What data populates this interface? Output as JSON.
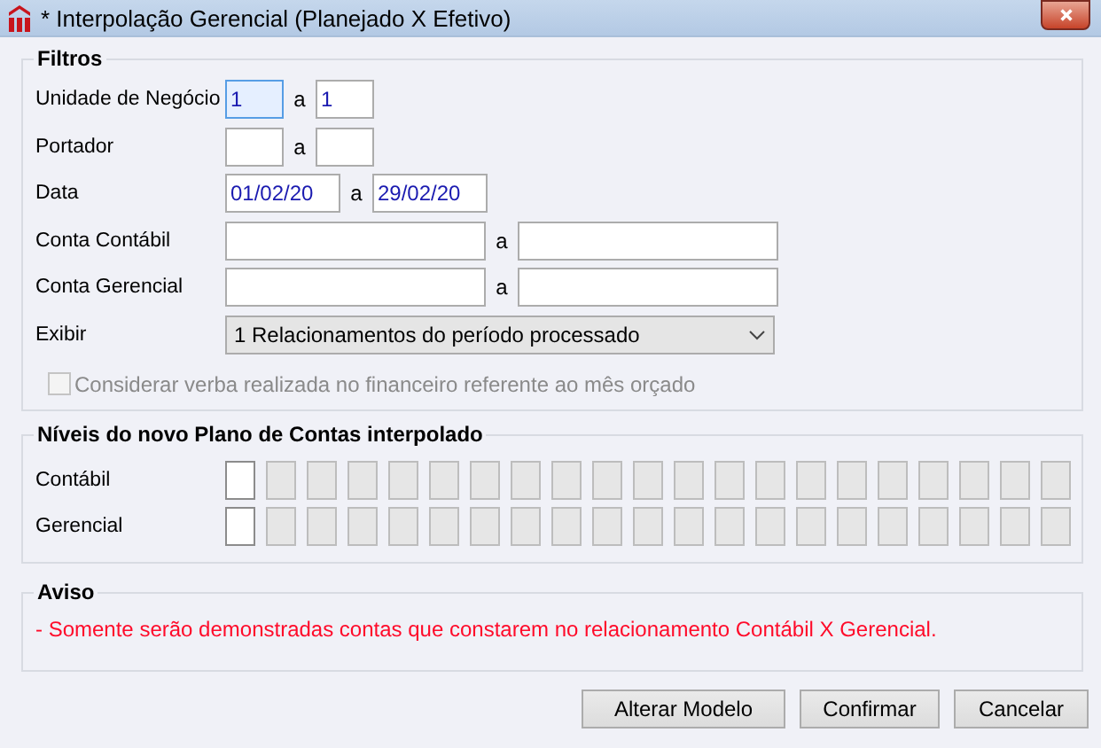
{
  "window": {
    "title": "* Interpolação Gerencial (Planejado X Efetivo)"
  },
  "filters": {
    "title": "Filtros",
    "rows": [
      {
        "kind": "range",
        "label": "Unidade de Negócio",
        "separator": "a",
        "from": {
          "value": "1",
          "focused": true
        },
        "to": {
          "value": "1",
          "focused": false
        }
      },
      {
        "kind": "range",
        "label": "Portador",
        "separator": "a",
        "from": {
          "focused": false
        },
        "to": {
          "focused": false
        }
      },
      {
        "kind": "range",
        "label": "Data",
        "separator": "a",
        "from": {
          "value": "01/02/20",
          "focused": false
        },
        "to": {
          "value": "29/02/20",
          "focused": false
        }
      },
      {
        "kind": "range",
        "label": "Conta Contábil",
        "separator": "a",
        "from": {
          "focused": false
        },
        "to": {
          "focused": false
        }
      },
      {
        "kind": "range",
        "label": "Conta Gerencial",
        "separator": "a",
        "from": {
          "focused": false
        },
        "to": {
          "focused": false
        }
      },
      {
        "kind": "select",
        "label": "Exibir",
        "value": "1 Relacionamentos do período processado"
      }
    ],
    "checkbox": {
      "label": "Considerar verba realizada no financeiro referente ao mês orçado",
      "checked": false,
      "disabled": true
    }
  },
  "levels": {
    "title": "Níveis do novo Plano de Contas interpolado",
    "rows": [
      {
        "label": "Contábil",
        "boxes": [
          {
            "disabled": false
          },
          {
            "disabled": true
          },
          {
            "disabled": true
          },
          {
            "disabled": true
          },
          {
            "disabled": true
          },
          {
            "disabled": true
          },
          {
            "disabled": true
          },
          {
            "disabled": true
          },
          {
            "disabled": true
          },
          {
            "disabled": true
          },
          {
            "disabled": true
          },
          {
            "disabled": true
          },
          {
            "disabled": true
          },
          {
            "disabled": true
          },
          {
            "disabled": true
          },
          {
            "disabled": true
          },
          {
            "disabled": true
          },
          {
            "disabled": true
          },
          {
            "disabled": true
          },
          {
            "disabled": true
          },
          {
            "disabled": true
          }
        ]
      },
      {
        "label": "Gerencial",
        "boxes": [
          {
            "disabled": false
          },
          {
            "disabled": true
          },
          {
            "disabled": true
          },
          {
            "disabled": true
          },
          {
            "disabled": true
          },
          {
            "disabled": true
          },
          {
            "disabled": true
          },
          {
            "disabled": true
          },
          {
            "disabled": true
          },
          {
            "disabled": true
          },
          {
            "disabled": true
          },
          {
            "disabled": true
          },
          {
            "disabled": true
          },
          {
            "disabled": true
          },
          {
            "disabled": true
          },
          {
            "disabled": true
          },
          {
            "disabled": true
          },
          {
            "disabled": true
          },
          {
            "disabled": true
          },
          {
            "disabled": true
          },
          {
            "disabled": true
          }
        ]
      }
    ]
  },
  "notice": {
    "title": "Aviso",
    "message": "- Somente serão demonstradas contas que constarem no relacionamento Contábil X Gerencial."
  },
  "buttons": [
    "Alterar Modelo",
    "Confirmar",
    "Cancelar"
  ]
}
